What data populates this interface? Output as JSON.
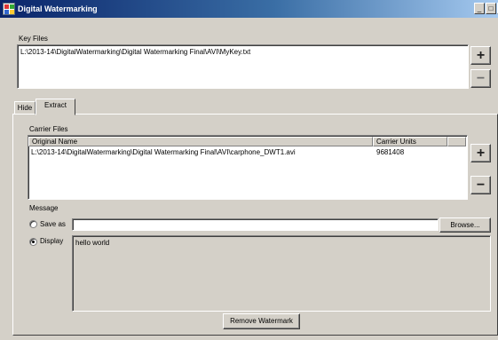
{
  "window": {
    "title": "Digital Watermarking",
    "minimize_glyph": "_",
    "maximize_glyph": "□",
    "close_glyph": "×"
  },
  "key_files": {
    "label": "Key Files",
    "items": [
      "L:\\2013-14\\DigitalWatermarking\\Digital Watermarking Final\\AVI\\MyKey.txt"
    ],
    "add_label": "+",
    "remove_label": "−"
  },
  "tabs": [
    {
      "label": "Hide",
      "selected": false
    },
    {
      "label": "Extract",
      "selected": true
    }
  ],
  "carrier_files": {
    "label": "Carrier Files",
    "columns": [
      "Original Name",
      "Carrier Units"
    ],
    "rows": [
      {
        "name": "L:\\2013-14\\DigitalWatermarking\\Digital Watermarking Final\\AVI\\carphone_DWT1.avi",
        "units": "9681408"
      }
    ],
    "add_label": "+",
    "remove_label": "−"
  },
  "message": {
    "label": "Message",
    "save_as_label": "Save as",
    "save_as_value": "",
    "browse_label": "Browse...",
    "display_label": "Display",
    "display_text": "hello world",
    "selected_option": "Display"
  },
  "remove_watermark_label": "Remove Watermark",
  "colors": {
    "titlebar_start": "#0a246a",
    "titlebar_end": "#a6caf0",
    "face": "#d4d0c8"
  }
}
